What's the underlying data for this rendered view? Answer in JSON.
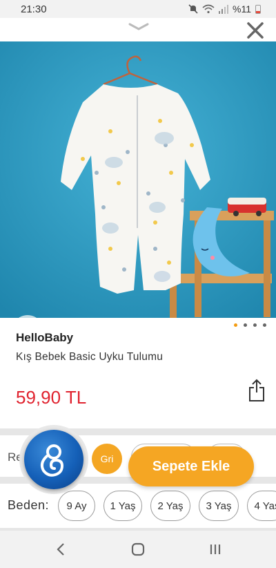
{
  "status_bar": {
    "time": "21:30",
    "battery": "%11"
  },
  "icons": {
    "chevron": "chevron-down-icon",
    "close": "close-icon",
    "favorite": "heart-icon",
    "share": "share-icon",
    "mute": "mute-icon",
    "wifi": "wifi-icon",
    "signal": "signal-icon",
    "battery": "battery-icon"
  },
  "product": {
    "brand": "HelloBaby",
    "name": "Kış Bebek Basic Uyku Tulumu",
    "price": "59,90 TL",
    "image_count": 4,
    "active_image": 1
  },
  "color": {
    "label": "Re",
    "selected": "Gri"
  },
  "size": {
    "label": "Beden:",
    "options": [
      "9 Ay",
      "1 Yaş",
      "2 Yaş",
      "3 Yaş",
      "4 Yaş"
    ]
  },
  "actions": {
    "add_to_cart": "Sepete Ekle"
  },
  "colors": {
    "accent": "#f5a623",
    "price": "#e0232f",
    "hero_bg": "#2f9ec4",
    "dot_active": "#f39c12"
  }
}
